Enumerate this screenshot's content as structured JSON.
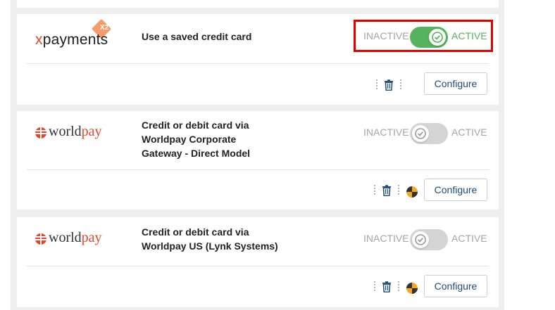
{
  "toggle": {
    "inactive_label": "INACTIVE",
    "active_label": "ACTIVE"
  },
  "configure_label": "Configure",
  "colors": {
    "active_green": "#55b35d",
    "highlight_red": "#e00000",
    "link_blue": "#1e4b7a",
    "worldpay_red": "#e8452c"
  },
  "methods": [
    {
      "logo": {
        "prefix": "x",
        "rest": "payments",
        "badge": "X2"
      },
      "title": "Use a saved credit card",
      "state": "active"
    },
    {
      "logo": {
        "prefix": "world",
        "rest": "pay"
      },
      "title": "Credit or debit card via Worldpay Corporate Gateway - Direct Model",
      "state": "inactive"
    },
    {
      "logo": {
        "prefix": "world",
        "rest": "pay"
      },
      "title": "Credit or debit card via Worldpay US (Lynk Systems)",
      "state": "inactive"
    }
  ]
}
